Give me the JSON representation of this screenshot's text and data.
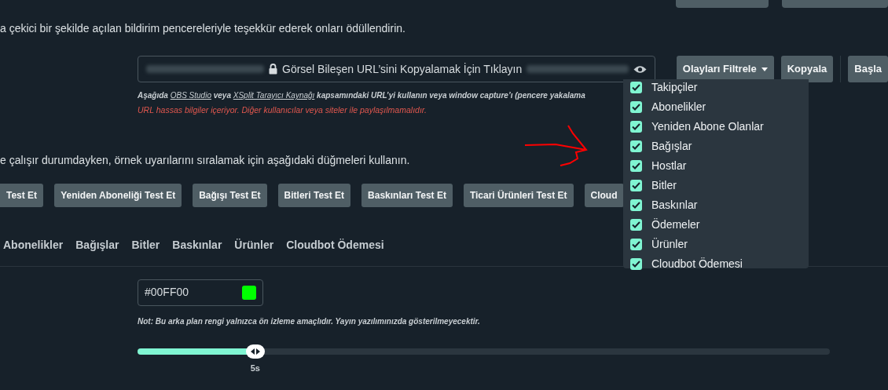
{
  "top_buttons": [
    {
      "kind": "blank"
    },
    {
      "kind": "blank"
    }
  ],
  "intro": "a çekici bir şekilde açılan bildirim pencereleriyle teşekkür ederek onları ödüllendirin.",
  "url_field": {
    "value": "Görsel Bileşen URL’sini Kopyalamak İçin Tıklayın"
  },
  "url_buttons": [
    {
      "label": "Olayları Filtrele",
      "kind": "dropdown"
    },
    {
      "label": "Kopyala",
      "kind": "plain"
    },
    {
      "label": "Başla",
      "kind": "plain"
    }
  ],
  "helper": [
    {
      "kind": "text",
      "text": "Aşağıda "
    },
    {
      "kind": "link",
      "text": "OBS Studio"
    },
    {
      "kind": "text",
      "text": " veya "
    },
    {
      "kind": "link",
      "text": "XSplit Tarayıcı Kaynağı"
    },
    {
      "kind": "text",
      "text": " kapsamındaki URL’yi kullanın veya window capture’ı (pencere yakalama"
    }
  ],
  "warning": "URL hassas bilgiler içeriyor. Diğer kullanıcılar veya siteler ile paylaşılmamalıdır.",
  "test_intro": "e çalışır durumdayken, örnek uyarılarını sıralamak için aşağıdaki düğmeleri kullanın.",
  "test_buttons": [
    "Test Et",
    "Yeniden Aboneliği Test Et",
    "Bağışı Test Et",
    "Bitleri Test Et",
    "Baskınları Test Et",
    "Ticari Ürünleri Test Et",
    "Cloud"
  ],
  "tabs": [
    {
      "label": "Abonelikler",
      "selected": false
    },
    {
      "label": "Bağışlar",
      "selected": false
    },
    {
      "label": "Bitler",
      "selected": false
    },
    {
      "label": "Baskınlar",
      "selected": false
    },
    {
      "label": "Ürünler",
      "selected": false
    },
    {
      "label": "Cloudbot Ödemesi",
      "selected": false
    }
  ],
  "color_field": {
    "value": "#00FF00",
    "color": "#00ff00"
  },
  "color_note": "Not: Bu arka plan rengi yalnızca ön izleme amaçlıdır. Yayın yazılımınızda gösterilmeyecektir.",
  "duration": {
    "level": 0.17,
    "reading": "5s"
  },
  "filter_menu": [
    {
      "label": "Takipçiler",
      "checked": true
    },
    {
      "label": "Abonelikler",
      "checked": true
    },
    {
      "label": "Yeniden Abone Olanlar",
      "checked": true
    },
    {
      "label": "Bağışlar",
      "checked": true
    },
    {
      "label": "Hostlar",
      "checked": true
    },
    {
      "label": "Bitler",
      "checked": true
    },
    {
      "label": "Baskınlar",
      "checked": true
    },
    {
      "label": "Ödemeler",
      "checked": true
    },
    {
      "label": "Ürünler",
      "checked": true
    },
    {
      "label": "Cloudbot Ödemesi",
      "checked": true
    }
  ],
  "annotation": {
    "kind": "arrow",
    "color": "#ff0000"
  }
}
